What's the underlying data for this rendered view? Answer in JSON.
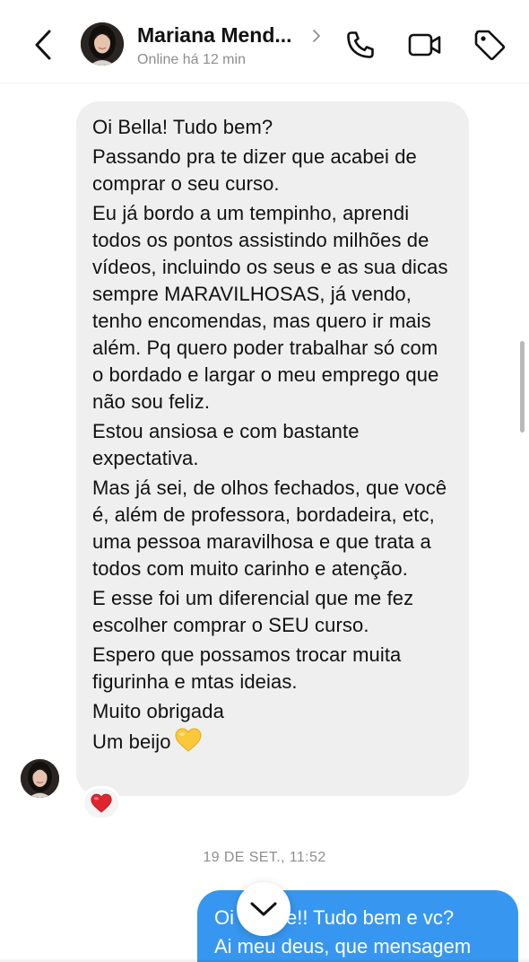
{
  "header": {
    "contact_name": "Mariana Mend...",
    "status": "Online há 12 min"
  },
  "icons": {
    "back": "chevron-left-icon",
    "profile_chevron": "chevron-right-icon",
    "call": "phone-icon",
    "video": "video-camera-icon",
    "label": "tag-icon",
    "reaction": "red-heart-emoji",
    "scroll": "chevron-down-icon"
  },
  "colors": {
    "incoming_bubble": "#efefef",
    "outgoing_bubble": "#3797f0",
    "secondary_text": "#8e8e8e"
  },
  "incoming_message": {
    "lines": [
      "Oi Bella! Tudo bem?",
      "Passando pra te dizer que acabei de comprar o seu curso.",
      "Eu já bordo a um tempinho, aprendi todos os pontos assistindo milhões de vídeos, incluindo os seus e as sua dicas sempre MARAVILHOSAS, já vendo, tenho encomendas, mas quero ir mais além. Pq quero poder trabalhar só com o bordado e largar o meu emprego que não sou feliz.",
      "Estou ansiosa e com bastante expectativa.",
      "Mas já sei, de olhos fechados, que você é, além de professora, bordadeira, etc, uma pessoa maravilhosa e que trata a todos com muito carinho e atenção.",
      "E esse foi um diferencial que me fez escolher comprar o SEU curso.",
      "Espero que possamos trocar muita figurinha e mtas ideias.",
      "Muito obrigada",
      "Um beijo"
    ],
    "closing_emoji": "💛",
    "reaction": "❤️"
  },
  "timestamp": "19 DE SET., 11:52",
  "outgoing_message": {
    "line1_start": "Oi",
    "line1_end": "e!! Tudo bem e vc?",
    "line2": "Ai meu deus, que mensagem"
  }
}
